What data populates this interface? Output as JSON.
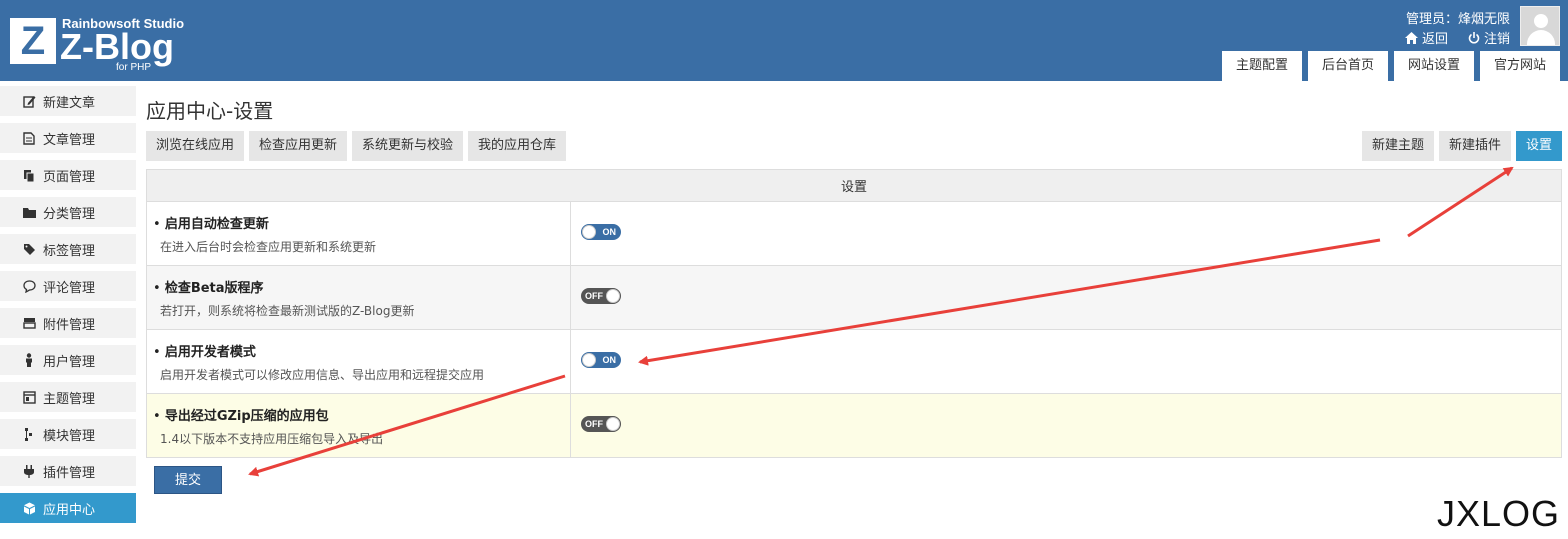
{
  "header": {
    "logo_letter": "Z",
    "studio": "Rainbowsoft Studio",
    "name": "Z-Blog",
    "sub": "for PHP",
    "admin_label": "管理员：烽烟无限",
    "back": "返回",
    "logout": "注销",
    "tabs": [
      "主题配置",
      "后台首页",
      "网站设置",
      "官方网站"
    ]
  },
  "sidebar": {
    "items": [
      {
        "label": "新建文章",
        "icon": "edit-icon"
      },
      {
        "label": "文章管理",
        "icon": "document-icon"
      },
      {
        "label": "页面管理",
        "icon": "pages-icon"
      },
      {
        "label": "分类管理",
        "icon": "folder-icon"
      },
      {
        "label": "标签管理",
        "icon": "tag-icon"
      },
      {
        "label": "评论管理",
        "icon": "comment-icon"
      },
      {
        "label": "附件管理",
        "icon": "attachment-icon"
      },
      {
        "label": "用户管理",
        "icon": "user-icon"
      },
      {
        "label": "主题管理",
        "icon": "theme-icon"
      },
      {
        "label": "模块管理",
        "icon": "module-icon"
      },
      {
        "label": "插件管理",
        "icon": "plugin-icon"
      },
      {
        "label": "应用中心",
        "icon": "app-center-icon"
      }
    ]
  },
  "main": {
    "title": "应用中心-设置",
    "sub_tabs": [
      "浏览在线应用",
      "检查应用更新",
      "系统更新与校验",
      "我的应用仓库"
    ],
    "right_tabs": [
      "新建主题",
      "新建插件",
      "设置"
    ],
    "table_header": "设置",
    "options": [
      {
        "title": "启用自动检查更新",
        "desc": "在进入后台时会检查应用更新和系统更新",
        "state": "ON"
      },
      {
        "title": "检查Beta版程序",
        "desc": "若打开，则系统将检查最新测试版的Z-Blog更新",
        "state": "OFF"
      },
      {
        "title": "启用开发者模式",
        "desc": "启用开发者模式可以修改应用信息、导出应用和远程提交应用",
        "state": "ON"
      },
      {
        "title": "导出经过GZip压缩的应用包",
        "desc": "1.4以下版本不支持应用压缩包导入及导出",
        "state": "OFF"
      }
    ],
    "submit": "提交"
  },
  "watermark": "JXLOG",
  "colors": {
    "header": "#3a6ea5",
    "active": "#3399cc",
    "arrow": "#e8403a"
  }
}
